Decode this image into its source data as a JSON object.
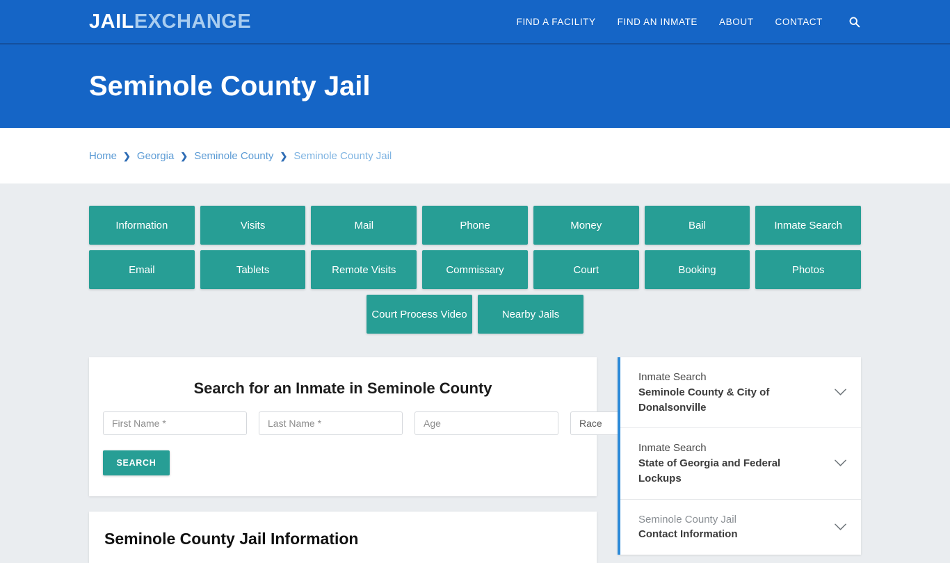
{
  "header": {
    "logo_primary": "JAIL",
    "logo_secondary": "EXCHANGE",
    "nav": [
      {
        "label": "FIND A FACILITY"
      },
      {
        "label": "FIND AN INMATE"
      },
      {
        "label": "ABOUT"
      },
      {
        "label": "CONTACT"
      }
    ],
    "search_icon": "search-icon",
    "brand_color": "#1565c6"
  },
  "page": {
    "title": "Seminole County Jail",
    "accent_teal": "#279e95",
    "accent_blue": "#2d8ad8"
  },
  "breadcrumb": {
    "separator": "❯",
    "items": [
      {
        "label": "Home"
      },
      {
        "label": "Georgia"
      },
      {
        "label": "Seminole County"
      },
      {
        "label": "Seminole County Jail"
      }
    ]
  },
  "nav_buttons": {
    "row1": [
      {
        "label": "Information"
      },
      {
        "label": "Visits"
      },
      {
        "label": "Mail"
      },
      {
        "label": "Phone"
      },
      {
        "label": "Money"
      },
      {
        "label": "Bail"
      },
      {
        "label": "Inmate Search"
      }
    ],
    "row2": [
      {
        "label": "Email"
      },
      {
        "label": "Tablets"
      },
      {
        "label": "Remote Visits"
      },
      {
        "label": "Commissary"
      },
      {
        "label": "Court"
      },
      {
        "label": "Booking"
      },
      {
        "label": "Photos"
      }
    ],
    "row3": [
      {
        "label": "Court Process Video"
      },
      {
        "label": "Nearby Jails"
      }
    ]
  },
  "inmate_search": {
    "heading": "Search for an Inmate in Seminole County",
    "first_name_placeholder": "First Name *",
    "first_name_value": "",
    "last_name_placeholder": "Last Name *",
    "last_name_value": "",
    "age_placeholder": "Age",
    "age_value": "",
    "race_selected": "Race",
    "race_options": [
      "Race"
    ],
    "submit_label": "SEARCH"
  },
  "info_section": {
    "title": "Seminole County Jail Information"
  },
  "sidebar": {
    "panels": [
      {
        "line1": "Inmate Search",
        "line2": "Seminole County & City of Donalsonville",
        "line1_muted": false,
        "icon": "chevron-down-icon"
      },
      {
        "line1": "Inmate Search",
        "line2": "State of Georgia and Federal Lockups",
        "line1_muted": false,
        "icon": "chevron-down-icon"
      },
      {
        "line1": "Seminole County Jail",
        "line2": "Contact Information",
        "line1_muted": true,
        "icon": "chevron-down-icon"
      }
    ]
  }
}
